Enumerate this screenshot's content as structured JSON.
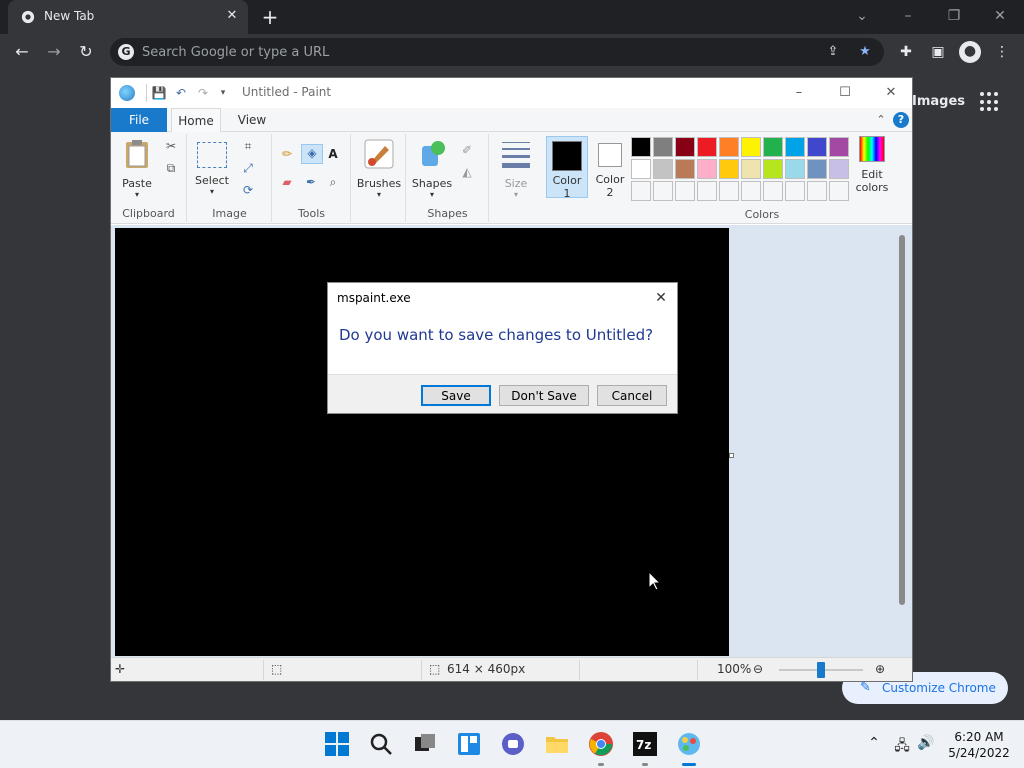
{
  "chrome": {
    "tab_title": "New Tab",
    "omnibox_placeholder": "Search Google or type a URL",
    "images_link": "Images",
    "customize_label": "Customize Chrome"
  },
  "paint": {
    "title": "Untitled - Paint",
    "tabs": {
      "file": "File",
      "home": "Home",
      "view": "View"
    },
    "groups": {
      "clipboard": "Clipboard",
      "image": "Image",
      "tools": "Tools",
      "shapes": "Shapes",
      "colors": "Colors"
    },
    "buttons": {
      "paste": "Paste",
      "select": "Select",
      "brushes": "Brushes",
      "shapes": "Shapes",
      "size": "Size",
      "color1_line1": "Color",
      "color1_line2": "1",
      "color2_line1": "Color",
      "color2_line2": "2",
      "edit_colors_line1": "Edit",
      "edit_colors_line2": "colors"
    },
    "palette": [
      "#000000",
      "#7f7f7f",
      "#880015",
      "#ed1c24",
      "#ff7f27",
      "#fff200",
      "#22b14c",
      "#00a2e8",
      "#3f48cc",
      "#a349a4",
      "#ffffff",
      "#c3c3c3",
      "#b97a57",
      "#ffaec9",
      "#ffc90e",
      "#efe4b0",
      "#b5e61d",
      "#99d9ea",
      "#7092be",
      "#c8bfe7",
      "#f5f6f7",
      "#f5f6f7",
      "#f5f6f7",
      "#f5f6f7",
      "#f5f6f7",
      "#f5f6f7",
      "#f5f6f7",
      "#f5f6f7",
      "#f5f6f7",
      "#f5f6f7"
    ],
    "status": {
      "dimensions": "614 × 460px",
      "zoom": "100%"
    }
  },
  "dialog": {
    "title": "mspaint.exe",
    "message": "Do you want to save changes to Untitled?",
    "save": "Save",
    "dont_save": "Don't Save",
    "cancel": "Cancel"
  },
  "taskbar": {
    "time": "6:20 AM",
    "date": "5/24/2022"
  },
  "icons": [
    "chrome-icon",
    "back-arrow-icon",
    "forward-arrow-icon",
    "reload-icon",
    "google-icon",
    "share-icon",
    "bookmark-star-icon",
    "extensions-icon",
    "side-panel-icon",
    "profile-icon",
    "menu-dots-icon",
    "apps-grid-icon",
    "pencil-icon",
    "paint-app-icon",
    "save-icon",
    "undo-icon",
    "redo-icon",
    "help-icon",
    "windows-start-icon",
    "search-icon",
    "file-explorer-icon",
    "7zip-icon"
  ]
}
